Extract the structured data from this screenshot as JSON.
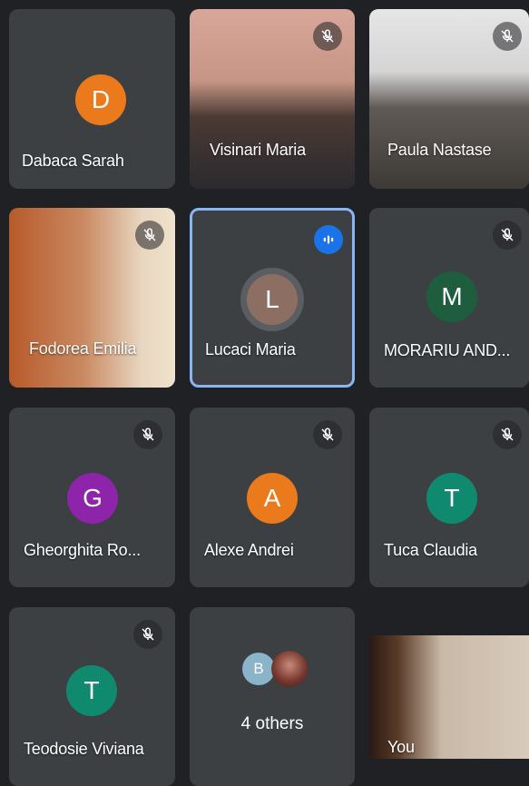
{
  "participants": [
    {
      "name": "Dabaca Sarah",
      "initial": "D",
      "color": "#ea7a1c"
    },
    {
      "name": "Visinari Maria"
    },
    {
      "name": "Paula Nastase"
    },
    {
      "name": "Fodorea Emilia"
    },
    {
      "name": "Lucaci Maria",
      "initial": "L",
      "color": "#8d6e63"
    },
    {
      "name": "MORARIU AND...",
      "initial": "M",
      "color": "#1e5e3e"
    },
    {
      "name": "Gheorghita Ro...",
      "initial": "G",
      "color": "#8e24aa"
    },
    {
      "name": "Alexe Andrei",
      "initial": "A",
      "color": "#ea7a1c"
    },
    {
      "name": "Tuca Claudia",
      "initial": "T",
      "color": "#0f8a6f"
    },
    {
      "name": "Teodosie Viviana",
      "initial": "T",
      "color": "#0f8a6f"
    },
    {
      "name": "You"
    }
  ],
  "others": {
    "label": "4 others",
    "initial": "B",
    "color": "#8ab4c9"
  },
  "icons": {
    "muted": "mic-off-icon",
    "speaking": "audio-wave-icon"
  }
}
